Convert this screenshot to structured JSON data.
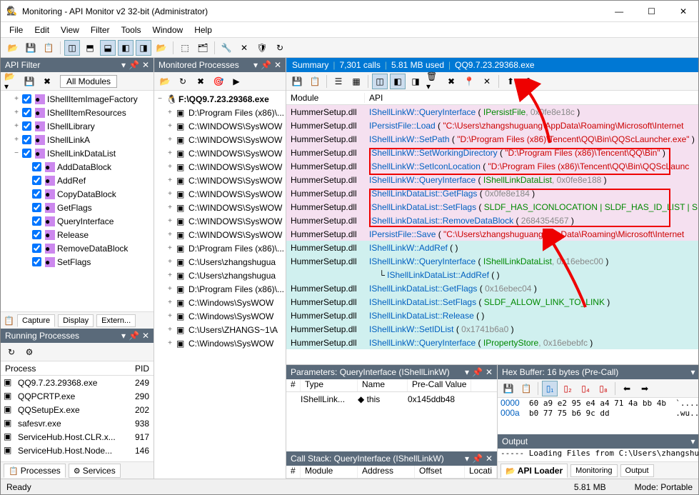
{
  "window": {
    "title": "Monitoring - API Monitor v2 32-bit (Administrator)"
  },
  "menu": [
    "File",
    "Edit",
    "View",
    "Filter",
    "Tools",
    "Window",
    "Help"
  ],
  "api_filter": {
    "title": "API Filter",
    "all_modules": "All Modules",
    "items": [
      {
        "label": "IShellItemImageFactory",
        "depth": 1,
        "exp": "+"
      },
      {
        "label": "IShellItemResources",
        "depth": 1,
        "exp": "+"
      },
      {
        "label": "IShellLibrary",
        "depth": 1,
        "exp": "+"
      },
      {
        "label": "IShellLinkA",
        "depth": 1,
        "exp": "+"
      },
      {
        "label": "IShellLinkDataList",
        "depth": 1,
        "exp": "−"
      },
      {
        "label": "AddDataBlock",
        "depth": 2,
        "exp": ""
      },
      {
        "label": "AddRef",
        "depth": 2,
        "exp": ""
      },
      {
        "label": "CopyDataBlock",
        "depth": 2,
        "exp": ""
      },
      {
        "label": "GetFlags",
        "depth": 2,
        "exp": ""
      },
      {
        "label": "QueryInterface",
        "depth": 2,
        "exp": ""
      },
      {
        "label": "Release",
        "depth": 2,
        "exp": ""
      },
      {
        "label": "RemoveDataBlock",
        "depth": 2,
        "exp": ""
      },
      {
        "label": "SetFlags",
        "depth": 2,
        "exp": ""
      }
    ],
    "tabs": [
      "Capture",
      "Display",
      "Extern..."
    ]
  },
  "running_processes": {
    "title": "Running Processes",
    "col1": "Process",
    "col2": "PID",
    "rows": [
      {
        "name": "QQ9.7.23.29368.exe",
        "pid": "249"
      },
      {
        "name": "QQPCRTP.exe",
        "pid": "290"
      },
      {
        "name": "QQSetupEx.exe",
        "pid": "202"
      },
      {
        "name": "safesvr.exe",
        "pid": "938"
      },
      {
        "name": "ServiceHub.Host.CLR.x...",
        "pid": "917"
      },
      {
        "name": "ServiceHub.Host.Node...",
        "pid": "146"
      }
    ],
    "tabs": [
      "Processes",
      "Services"
    ]
  },
  "monitored": {
    "title": "Monitored Processes",
    "root": "F:\\QQ9.7.23.29368.exe",
    "items": [
      "D:\\Program Files (x86)\\...",
      "C:\\WINDOWS\\SysWOW",
      "C:\\WINDOWS\\SysWOW",
      "C:\\WINDOWS\\SysWOW",
      "C:\\WINDOWS\\SysWOW",
      "C:\\WINDOWS\\SysWOW",
      "C:\\WINDOWS\\SysWOW",
      "C:\\WINDOWS\\SysWOW",
      "C:\\WINDOWS\\SysWOW",
      "C:\\WINDOWS\\SysWOW",
      "D:\\Program Files (x86)\\...",
      "C:\\Users\\zhangshugua",
      "C:\\Users\\zhangshugua",
      "D:\\Program Files (x86)\\...",
      "C:\\Windows\\SysWOW",
      "C:\\Windows\\SysWOW",
      "C:\\Users\\ZHANGS~1\\A",
      "C:\\Windows\\SysWOW"
    ]
  },
  "summary": {
    "label": "Summary",
    "calls": "7,301 calls",
    "mem": "5.81 MB used",
    "exe": "QQ9.7.23.29368.exe",
    "col_module": "Module",
    "col_api": "API",
    "rows": [
      {
        "bg": "pink",
        "mod": "HummerSetup.dll",
        "cls": "IShellLinkW",
        "method": "QueryInterface",
        "pre": " ( ",
        "green": "IPersistFile",
        "gray": ", 0x0fe8e18c",
        "post": " )"
      },
      {
        "bg": "pink",
        "mod": "HummerSetup.dll",
        "cls": "IPersistFile",
        "method": "Load",
        "pre": " ( ",
        "val": "\"C:\\Users\\zhangshuguang\\AppData\\Roaming\\Microsoft\\Internet",
        "post": ""
      },
      {
        "bg": "pink",
        "mod": "HummerSetup.dll",
        "cls": "IShellLinkW",
        "method": "SetPath",
        "pre": " ( ",
        "val": "\"D:\\Program Files (x86)\\Tencent\\QQ\\Bin\\QQScLauncher.exe\"",
        "post": " )"
      },
      {
        "bg": "pink",
        "mod": "HummerSetup.dll",
        "cls": "IShellLinkW",
        "method": "SetWorkingDirectory",
        "pre": " ( ",
        "val": "\"D:\\Program Files (x86)\\Tencent\\QQ\\Bin\"",
        "post": " )"
      },
      {
        "bg": "pink",
        "mod": "HummerSetup.dll",
        "cls": "IShellLinkW",
        "method": "SetIconLocation",
        "pre": " ( ",
        "val": "\"D:\\Program Files (x86)\\Tencent\\QQ\\Bin\\QQScLaunc",
        "post": ""
      },
      {
        "bg": "pink",
        "mod": "HummerSetup.dll",
        "cls": "IShellLinkW",
        "method": "QueryInterface",
        "pre": " ( ",
        "green": "IShellLinkDataList",
        "gray": ", 0x0fe8e188",
        "post": " )"
      },
      {
        "bg": "pink",
        "mod": "HummerSetup.dll",
        "cls": "IShellLinkDataList",
        "method": "GetFlags",
        "pre": " ( ",
        "gray": "0x0fe8e184",
        "post": " )"
      },
      {
        "bg": "pink",
        "mod": "HummerSetup.dll",
        "cls": "IShellLinkDataList",
        "method": "SetFlags",
        "pre": " ( ",
        "green": "SLDF_HAS_ICONLOCATION | SLDF_HAS_ID_LIST | SLDF_H",
        "post": ""
      },
      {
        "bg": "pink",
        "mod": "HummerSetup.dll",
        "cls": "IShellLinkDataList",
        "method": "RemoveDataBlock",
        "pre": " ( ",
        "gray": "2684354567",
        "post": " )"
      },
      {
        "bg": "pink",
        "mod": "HummerSetup.dll",
        "cls": "IPersistFile",
        "method": "Save",
        "pre": " ( ",
        "val": "\"C:\\Users\\zhangshuguang\\AppData\\Roaming\\Microsoft\\Internet",
        "post": ""
      },
      {
        "bg": "cyan",
        "mod": "HummerSetup.dll",
        "cls": "IShellLinkW",
        "method": "AddRef",
        "pre": " ( ",
        "post": " )"
      },
      {
        "bg": "cyan",
        "mod": "HummerSetup.dll",
        "cls": "IShellLinkW",
        "method": "QueryInterface",
        "pre": " ( ",
        "green": "IShellLinkDataList",
        "gray": ", 0x16ebec00",
        "post": " )"
      },
      {
        "bg": "cyan",
        "mod": "",
        "indent": true,
        "cls": "IShellLinkDataList",
        "method": "AddRef",
        "pre": " ( ",
        "post": " )"
      },
      {
        "bg": "cyan",
        "mod": "HummerSetup.dll",
        "cls": "IShellLinkDataList",
        "method": "GetFlags",
        "pre": " ( ",
        "gray": "0x16ebec04",
        "post": " )"
      },
      {
        "bg": "cyan",
        "mod": "HummerSetup.dll",
        "cls": "IShellLinkDataList",
        "method": "SetFlags",
        "pre": " ( ",
        "green": "SLDF_ALLOW_LINK_TO_LINK",
        "post": " )"
      },
      {
        "bg": "cyan",
        "mod": "HummerSetup.dll",
        "cls": "IShellLinkDataList",
        "method": "Release",
        "pre": " ( ",
        "post": " )"
      },
      {
        "bg": "cyan",
        "mod": "HummerSetup.dll",
        "cls": "IShellLinkW",
        "method": "SetIDList",
        "pre": " ( ",
        "gray": "0x1741b6a0",
        "post": " )"
      },
      {
        "bg": "cyan",
        "mod": "HummerSetup.dll",
        "cls": "IShellLinkW",
        "method": "QueryInterface",
        "pre": " ( ",
        "green": "IPropertyStore",
        "gray": ", 0x16ebebfc",
        "post": " )"
      }
    ]
  },
  "parameters": {
    "title": "Parameters: QueryInterface (IShellLinkW)",
    "cols": [
      "#",
      "Type",
      "Name",
      "Pre-Call Value"
    ],
    "row": {
      "type": "IShellLink...",
      "name": "this",
      "val": "0x145ddb48"
    }
  },
  "hex": {
    "title": "Hex Buffer: 16 bytes (Pre-Call)",
    "rows": [
      {
        "addr": "0000",
        "hex": "  60 a9 e2 95 e4 a4 71 4a bb 4b  ",
        "ascii": "`.....qJ.K"
      },
      {
        "addr": "000a",
        "hex": "  b0 77 75 b6 9c dd              ",
        "ascii": ".wu..."
      }
    ]
  },
  "callstack": {
    "title": "Call Stack: QueryInterface (IShellLinkW)",
    "cols": [
      "#",
      "Module",
      "Address",
      "Offset",
      "Locati"
    ]
  },
  "output": {
    "title": "Output",
    "text": "----- Loading Files from C:\\Users\\zhangshuguan",
    "tabs": [
      "API Loader",
      "Monitoring",
      "Output"
    ]
  },
  "status": {
    "ready": "Ready",
    "mem": "5.81 MB",
    "mode": "Mode: Portable"
  }
}
